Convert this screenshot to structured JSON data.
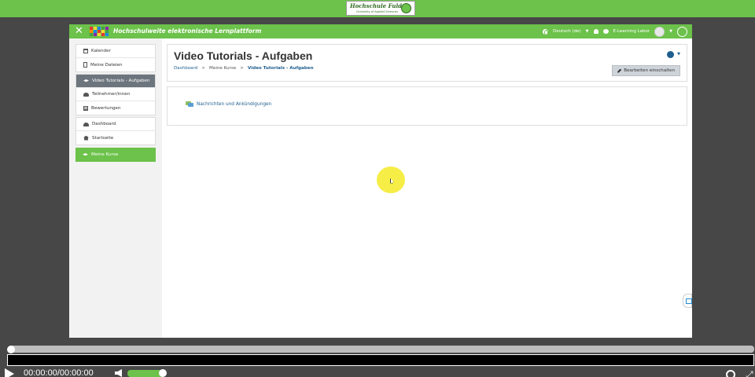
{
  "brand": {
    "title": "Hochschule Fulda",
    "subtitle": "University of Applied Sciences",
    "emblem": "university-emblem"
  },
  "navbar": {
    "site_name": "Hochschulweite elektronische Lernplattform",
    "language": "Deutsch (de)",
    "user_name": "E-Learning Labor",
    "accent_color": "#6cc24a"
  },
  "sidebar": {
    "group1": [
      {
        "label": "Kalender",
        "icon": "calendar-icon"
      },
      {
        "label": "Meine Dateien",
        "icon": "file-icon"
      }
    ],
    "group2": [
      {
        "label": "Video Tutorials - Aufgaben",
        "icon": "graduation-cap-icon",
        "active": true
      },
      {
        "label": "Teilnehmer/innen",
        "icon": "users-icon"
      },
      {
        "label": "Bewertungen",
        "icon": "table-icon"
      }
    ],
    "group3": [
      {
        "label": "Dashboard",
        "icon": "dashboard-icon"
      },
      {
        "label": "Startseite",
        "icon": "home-icon"
      }
    ],
    "group4": [
      {
        "label": "Meine Kurse",
        "icon": "graduation-cap-icon"
      }
    ]
  },
  "header": {
    "title": "Video Tutorials - Aufgaben",
    "breadcrumb": [
      "Dashboard",
      "Meine Kurse",
      "Video Tutorials - Aufgaben"
    ],
    "separator": ">",
    "edit_button": "Bearbeiten einschalten"
  },
  "content": {
    "forum_link": "Nachrichten und Ankündigungen"
  },
  "player": {
    "time": "00:00:00/00:00:00",
    "progress_fraction": 0.0,
    "volume_fraction": 0.85
  }
}
